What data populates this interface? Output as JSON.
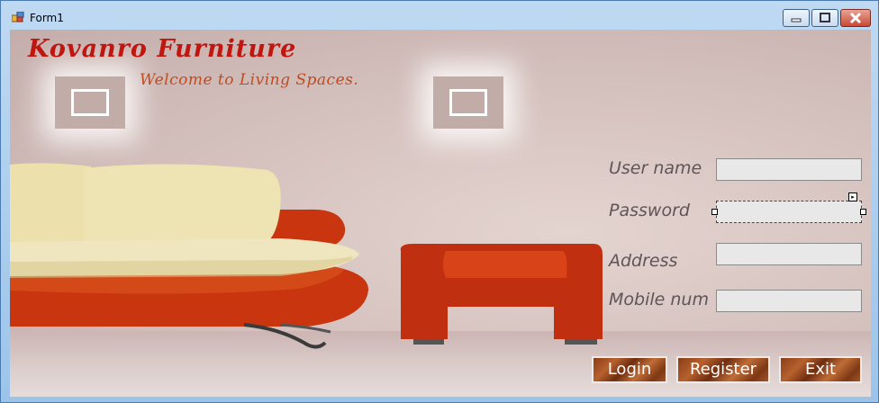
{
  "window": {
    "title": "Form1"
  },
  "brand": {
    "name": "Kovanro Furniture",
    "tagline": "Welcome to Living Spaces."
  },
  "form": {
    "username_label": "User name",
    "password_label": "Password",
    "address_label": "Address",
    "mobile_label": "Mobile num",
    "username_value": "",
    "password_value": "",
    "address_value": "",
    "mobile_value": ""
  },
  "buttons": {
    "login": "Login",
    "register": "Register",
    "exit": "Exit"
  },
  "colors": {
    "heading": "#c0160f",
    "tagline": "#c24a1e",
    "sofa": "#c8350f",
    "cushion": "#eee0a8"
  }
}
